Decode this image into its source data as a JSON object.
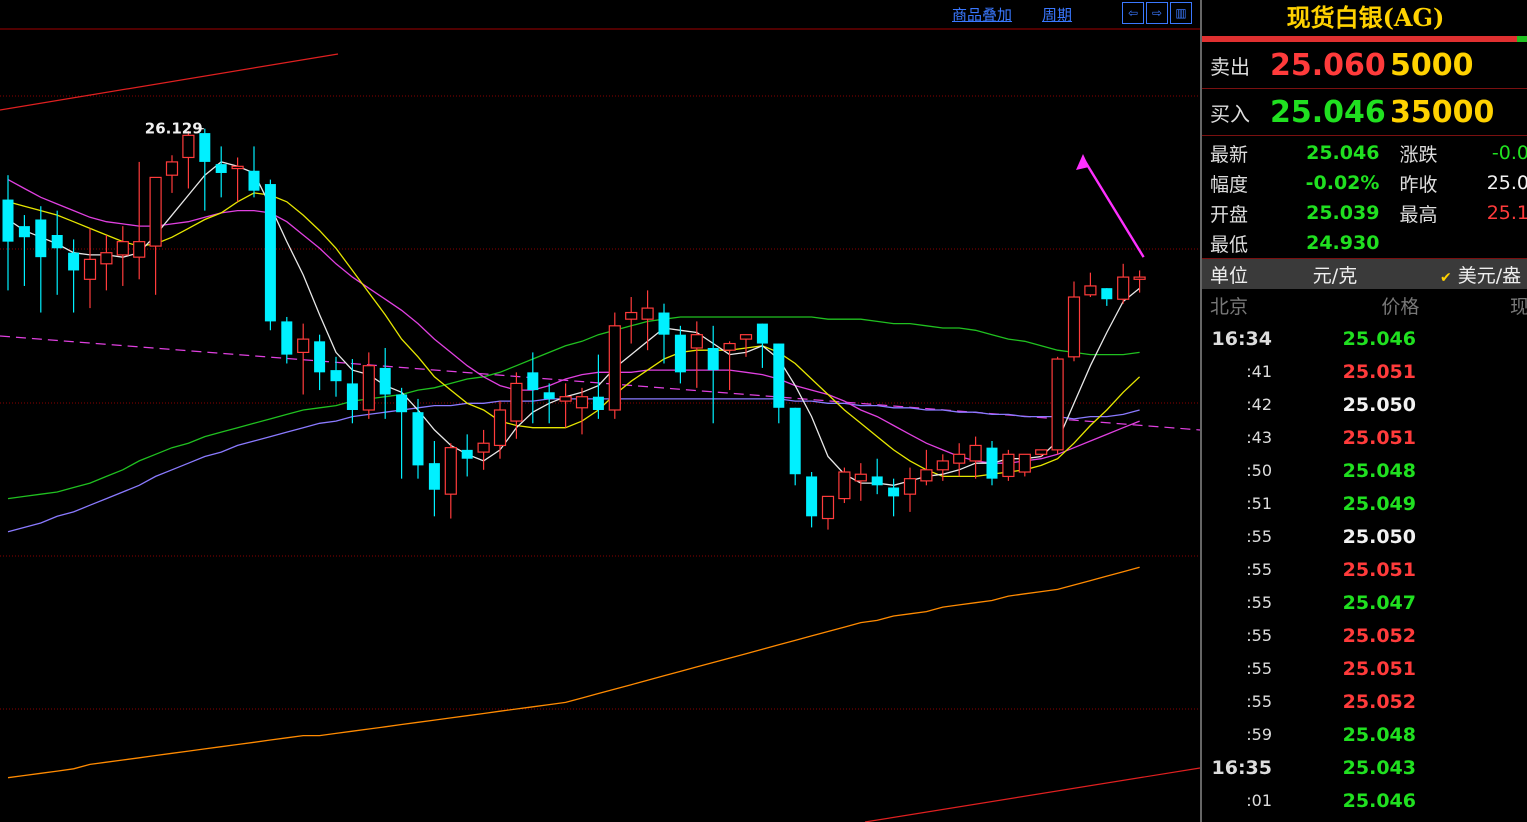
{
  "toolbar": {
    "overlay_label": "商品叠加",
    "period_label": "周期"
  },
  "colors": {
    "up": "#ff3b3b",
    "down": "#00f0ff",
    "ma5": "#e8e8e8",
    "ma10": "#e6e600",
    "ma20": "#e040e0",
    "ma30": "#20c020",
    "ma60": "#8a7aff",
    "ma120": "#ff8a00",
    "grid": "#8a0000"
  },
  "chart_data": {
    "type": "candlestick",
    "high_annotation": "26.129",
    "candles": [
      {
        "o": 25.81,
        "h": 25.92,
        "l": 25.4,
        "c": 25.62
      },
      {
        "o": 25.69,
        "h": 25.74,
        "l": 25.42,
        "c": 25.64
      },
      {
        "o": 25.72,
        "h": 25.78,
        "l": 25.3,
        "c": 25.55
      },
      {
        "o": 25.65,
        "h": 25.76,
        "l": 25.38,
        "c": 25.59
      },
      {
        "o": 25.57,
        "h": 25.63,
        "l": 25.3,
        "c": 25.49
      },
      {
        "o": 25.45,
        "h": 25.68,
        "l": 25.32,
        "c": 25.54
      },
      {
        "o": 25.52,
        "h": 25.65,
        "l": 25.4,
        "c": 25.57
      },
      {
        "o": 25.56,
        "h": 25.69,
        "l": 25.42,
        "c": 25.62
      },
      {
        "o": 25.55,
        "h": 25.98,
        "l": 25.45,
        "c": 25.62
      },
      {
        "o": 25.6,
        "h": 25.91,
        "l": 25.38,
        "c": 25.91
      },
      {
        "o": 25.92,
        "h": 26.01,
        "l": 25.84,
        "c": 25.98
      },
      {
        "o": 26.0,
        "h": 26.12,
        "l": 25.86,
        "c": 26.1
      },
      {
        "o": 26.11,
        "h": 26.13,
        "l": 25.76,
        "c": 25.98
      },
      {
        "o": 25.97,
        "h": 26.05,
        "l": 25.82,
        "c": 25.93
      },
      {
        "o": 25.95,
        "h": 26.0,
        "l": 25.8,
        "c": 25.96
      },
      {
        "o": 25.94,
        "h": 26.05,
        "l": 25.82,
        "c": 25.85
      },
      {
        "o": 25.88,
        "h": 25.9,
        "l": 25.22,
        "c": 25.26
      },
      {
        "o": 25.26,
        "h": 25.28,
        "l": 25.07,
        "c": 25.11
      },
      {
        "o": 25.12,
        "h": 25.25,
        "l": 24.93,
        "c": 25.18
      },
      {
        "o": 25.17,
        "h": 25.2,
        "l": 24.95,
        "c": 25.03
      },
      {
        "o": 25.04,
        "h": 25.1,
        "l": 24.92,
        "c": 24.99
      },
      {
        "o": 24.98,
        "h": 25.09,
        "l": 24.8,
        "c": 24.86
      },
      {
        "o": 24.86,
        "h": 25.12,
        "l": 24.82,
        "c": 25.06
      },
      {
        "o": 25.05,
        "h": 25.14,
        "l": 24.82,
        "c": 24.93
      },
      {
        "o": 24.93,
        "h": 24.96,
        "l": 24.55,
        "c": 24.85
      },
      {
        "o": 24.85,
        "h": 24.91,
        "l": 24.55,
        "c": 24.61
      },
      {
        "o": 24.62,
        "h": 24.72,
        "l": 24.38,
        "c": 24.5
      },
      {
        "o": 24.48,
        "h": 24.71,
        "l": 24.37,
        "c": 24.69
      },
      {
        "o": 24.68,
        "h": 24.75,
        "l": 24.56,
        "c": 24.64
      },
      {
        "o": 24.67,
        "h": 24.77,
        "l": 24.59,
        "c": 24.71
      },
      {
        "o": 24.7,
        "h": 24.9,
        "l": 24.64,
        "c": 24.86
      },
      {
        "o": 24.81,
        "h": 25.03,
        "l": 24.73,
        "c": 24.98
      },
      {
        "o": 25.03,
        "h": 25.12,
        "l": 24.8,
        "c": 24.95
      },
      {
        "o": 24.94,
        "h": 24.98,
        "l": 24.8,
        "c": 24.91
      },
      {
        "o": 24.9,
        "h": 24.98,
        "l": 24.78,
        "c": 24.92
      },
      {
        "o": 24.87,
        "h": 24.96,
        "l": 24.75,
        "c": 24.92
      },
      {
        "o": 24.92,
        "h": 25.11,
        "l": 24.82,
        "c": 24.86
      },
      {
        "o": 24.86,
        "h": 25.3,
        "l": 24.82,
        "c": 25.24
      },
      {
        "o": 25.27,
        "h": 25.37,
        "l": 25.16,
        "c": 25.3
      },
      {
        "o": 25.27,
        "h": 25.4,
        "l": 25.13,
        "c": 25.32
      },
      {
        "o": 25.3,
        "h": 25.34,
        "l": 25.07,
        "c": 25.2
      },
      {
        "o": 25.2,
        "h": 25.24,
        "l": 24.98,
        "c": 25.03
      },
      {
        "o": 25.14,
        "h": 25.26,
        "l": 24.96,
        "c": 25.2
      },
      {
        "o": 25.14,
        "h": 25.24,
        "l": 24.8,
        "c": 25.04
      },
      {
        "o": 25.13,
        "h": 25.17,
        "l": 24.95,
        "c": 25.16
      },
      {
        "o": 25.18,
        "h": 25.2,
        "l": 25.1,
        "c": 25.2
      },
      {
        "o": 25.25,
        "h": 25.25,
        "l": 25.05,
        "c": 25.16
      },
      {
        "o": 25.16,
        "h": 25.16,
        "l": 24.8,
        "c": 24.87
      },
      {
        "o": 24.87,
        "h": 24.87,
        "l": 24.52,
        "c": 24.57
      },
      {
        "o": 24.56,
        "h": 24.58,
        "l": 24.33,
        "c": 24.38
      },
      {
        "o": 24.37,
        "h": 24.46,
        "l": 24.32,
        "c": 24.47
      },
      {
        "o": 24.46,
        "h": 24.6,
        "l": 24.44,
        "c": 24.58
      },
      {
        "o": 24.54,
        "h": 24.62,
        "l": 24.45,
        "c": 24.57
      },
      {
        "o": 24.56,
        "h": 24.64,
        "l": 24.48,
        "c": 24.52
      },
      {
        "o": 24.51,
        "h": 24.55,
        "l": 24.38,
        "c": 24.47
      },
      {
        "o": 24.48,
        "h": 24.6,
        "l": 24.4,
        "c": 24.55
      },
      {
        "o": 24.54,
        "h": 24.68,
        "l": 24.52,
        "c": 24.59
      },
      {
        "o": 24.59,
        "h": 24.66,
        "l": 24.54,
        "c": 24.63
      },
      {
        "o": 24.62,
        "h": 24.71,
        "l": 24.56,
        "c": 24.66
      },
      {
        "o": 24.63,
        "h": 24.74,
        "l": 24.55,
        "c": 24.7
      },
      {
        "o": 24.69,
        "h": 24.72,
        "l": 24.52,
        "c": 24.55
      },
      {
        "o": 24.56,
        "h": 24.68,
        "l": 24.54,
        "c": 24.66
      },
      {
        "o": 24.58,
        "h": 24.66,
        "l": 24.56,
        "c": 24.66
      },
      {
        "o": 24.66,
        "h": 24.68,
        "l": 24.65,
        "c": 24.68
      },
      {
        "o": 24.68,
        "h": 25.1,
        "l": 24.66,
        "c": 25.09
      },
      {
        "o": 25.1,
        "h": 25.44,
        "l": 25.08,
        "c": 25.37
      },
      {
        "o": 25.38,
        "h": 25.48,
        "l": 25.37,
        "c": 25.42
      },
      {
        "o": 25.41,
        "h": 25.41,
        "l": 25.33,
        "c": 25.36
      },
      {
        "o": 25.36,
        "h": 25.52,
        "l": 25.34,
        "c": 25.46
      },
      {
        "o": 25.45,
        "h": 25.49,
        "l": 25.39,
        "c": 25.46
      }
    ],
    "ma5": [
      25.72,
      25.67,
      25.64,
      25.61,
      25.57,
      25.56,
      25.56,
      25.55,
      25.57,
      25.65,
      25.74,
      25.83,
      25.92,
      25.98,
      25.96,
      25.93,
      25.78,
      25.62,
      25.47,
      25.29,
      25.12,
      25.04,
      25.02,
      24.97,
      24.94,
      24.86,
      24.77,
      24.7,
      24.66,
      24.63,
      24.68,
      24.78,
      24.85,
      24.89,
      24.92,
      24.94,
      24.97,
      25.05,
      25.11,
      25.17,
      25.23,
      25.22,
      25.21,
      25.16,
      25.11,
      25.12,
      25.15,
      25.09,
      24.97,
      24.83,
      24.65,
      24.57,
      24.53,
      24.53,
      24.52,
      24.54,
      24.56,
      24.57,
      24.59,
      24.62,
      24.62,
      24.64,
      24.64,
      24.65,
      24.72,
      24.89,
      25.06,
      25.21,
      25.35,
      25.41
    ],
    "ma10": [
      25.8,
      25.78,
      25.76,
      25.74,
      25.71,
      25.68,
      25.65,
      25.62,
      25.6,
      25.61,
      25.64,
      25.68,
      25.72,
      25.75,
      25.8,
      25.84,
      25.83,
      25.8,
      25.74,
      25.67,
      25.59,
      25.49,
      25.39,
      25.29,
      25.18,
      25.1,
      25.01,
      24.95,
      24.89,
      24.86,
      24.81,
      24.79,
      24.78,
      24.78,
      24.78,
      24.81,
      24.86,
      24.93,
      24.99,
      25.04,
      25.09,
      25.12,
      25.13,
      25.13,
      25.13,
      25.14,
      25.15,
      25.12,
      25.07,
      25.0,
      24.93,
      24.86,
      24.8,
      24.74,
      24.68,
      24.63,
      24.59,
      24.56,
      24.56,
      24.56,
      24.57,
      24.58,
      24.59,
      24.61,
      24.64,
      24.71,
      24.79,
      24.86,
      24.94,
      25.01
    ],
    "ma20": [
      25.9,
      25.86,
      25.82,
      25.79,
      25.76,
      25.73,
      25.71,
      25.7,
      25.69,
      25.69,
      25.7,
      25.71,
      25.73,
      25.75,
      25.76,
      25.76,
      25.75,
      25.71,
      25.65,
      25.59,
      25.52,
      25.46,
      25.41,
      25.36,
      25.31,
      25.25,
      25.18,
      25.12,
      25.06,
      25.01,
      24.97,
      24.95,
      24.95,
      24.97,
      25.0,
      25.02,
      25.03,
      25.03,
      25.03,
      25.04,
      25.04,
      25.04,
      25.04,
      25.04,
      25.04,
      25.03,
      25.02,
      25.0,
      24.97,
      24.95,
      24.93,
      24.9,
      24.86,
      24.83,
      24.79,
      24.75,
      24.71,
      24.68,
      24.65,
      24.63,
      24.62,
      24.62,
      24.63,
      24.64,
      24.66,
      24.69,
      24.72,
      24.75,
      24.78,
      24.81
    ],
    "ma30": [
      24.46,
      24.47,
      24.48,
      24.49,
      24.51,
      24.53,
      24.56,
      24.59,
      24.63,
      24.66,
      24.69,
      24.71,
      24.74,
      24.76,
      24.78,
      24.8,
      24.82,
      24.84,
      24.86,
      24.87,
      24.88,
      24.9,
      24.91,
      24.92,
      24.93,
      24.95,
      24.96,
      24.98,
      25.0,
      25.01,
      25.03,
      25.06,
      25.09,
      25.12,
      25.15,
      25.17,
      25.2,
      25.22,
      25.24,
      25.26,
      25.27,
      25.28,
      25.28,
      25.28,
      25.28,
      25.28,
      25.28,
      25.28,
      25.28,
      25.28,
      25.27,
      25.27,
      25.27,
      25.26,
      25.25,
      25.25,
      25.24,
      25.23,
      25.23,
      25.22,
      25.2,
      25.18,
      25.17,
      25.15,
      25.13,
      25.12,
      25.11,
      25.11,
      25.11,
      25.12
    ],
    "ma60": [
      24.31,
      24.33,
      24.35,
      24.38,
      24.4,
      24.43,
      24.46,
      24.49,
      24.52,
      24.56,
      24.59,
      24.62,
      24.65,
      24.67,
      24.7,
      24.72,
      24.74,
      24.76,
      24.78,
      24.8,
      24.81,
      24.83,
      24.84,
      24.85,
      24.86,
      24.87,
      24.88,
      24.88,
      24.89,
      24.89,
      24.9,
      24.9,
      24.9,
      24.91,
      24.91,
      24.91,
      24.91,
      24.91,
      24.91,
      24.91,
      24.91,
      24.91,
      24.91,
      24.91,
      24.91,
      24.91,
      24.91,
      24.91,
      24.9,
      24.9,
      24.89,
      24.89,
      24.88,
      24.88,
      24.87,
      24.87,
      24.86,
      24.86,
      24.85,
      24.85,
      24.84,
      24.84,
      24.83,
      24.83,
      24.83,
      24.82,
      24.83,
      24.83,
      24.84,
      24.86
    ],
    "ma120": [
      23.2,
      23.21,
      23.22,
      23.23,
      23.24,
      23.26,
      23.27,
      23.28,
      23.29,
      23.3,
      23.31,
      23.32,
      23.33,
      23.34,
      23.35,
      23.36,
      23.37,
      23.38,
      23.39,
      23.39,
      23.4,
      23.41,
      23.42,
      23.43,
      23.44,
      23.45,
      23.46,
      23.47,
      23.48,
      23.49,
      23.5,
      23.51,
      23.52,
      23.53,
      23.54,
      23.56,
      23.58,
      23.6,
      23.62,
      23.64,
      23.66,
      23.68,
      23.7,
      23.72,
      23.74,
      23.76,
      23.78,
      23.8,
      23.82,
      23.84,
      23.86,
      23.88,
      23.9,
      23.91,
      23.93,
      23.94,
      23.95,
      23.97,
      23.98,
      23.99,
      24.0,
      24.02,
      24.03,
      24.04,
      24.05,
      24.07,
      24.09,
      24.11,
      24.13,
      24.15
    ],
    "ylim": [
      23.0,
      26.58
    ]
  },
  "quote": {
    "title": "现货白银(AG)",
    "ask_label": "卖出",
    "ask_price": "25.060",
    "ask_vol": "5000",
    "bid_label": "买入",
    "bid_price": "25.046",
    "bid_vol": "35000",
    "stats": [
      {
        "k": "最新",
        "v": "25.046",
        "k2": "涨跌",
        "v2": "-0.0"
      },
      {
        "k": "幅度",
        "v": "-0.02%",
        "k2": "昨收",
        "v2": "25.0"
      },
      {
        "k": "开盘",
        "v": "25.039",
        "k2": "最高",
        "v2": "25.1"
      },
      {
        "k": "最低",
        "v": "24.930",
        "k2": "",
        "v2": ""
      }
    ],
    "unit_label": "单位",
    "unit_value": "元/克",
    "unit_alt": "美元/盎",
    "tick_head": {
      "c1": "北京",
      "c2": "价格",
      "c3": "现"
    },
    "ticks": [
      {
        "t": "16:34",
        "p": "25.046",
        "c": "green",
        "hh": true
      },
      {
        "t": ":41",
        "p": "25.051",
        "c": "red"
      },
      {
        "t": ":42",
        "p": "25.050",
        "c": "white"
      },
      {
        "t": ":43",
        "p": "25.051",
        "c": "red"
      },
      {
        "t": ":50",
        "p": "25.048",
        "c": "green"
      },
      {
        "t": ":51",
        "p": "25.049",
        "c": "green"
      },
      {
        "t": ":55",
        "p": "25.050",
        "c": "white"
      },
      {
        "t": ":55",
        "p": "25.051",
        "c": "red"
      },
      {
        "t": ":55",
        "p": "25.047",
        "c": "green"
      },
      {
        "t": ":55",
        "p": "25.052",
        "c": "red"
      },
      {
        "t": ":55",
        "p": "25.051",
        "c": "red"
      },
      {
        "t": ":55",
        "p": "25.052",
        "c": "red"
      },
      {
        "t": ":59",
        "p": "25.048",
        "c": "green"
      },
      {
        "t": "16:35",
        "p": "25.043",
        "c": "green",
        "hh": true
      },
      {
        "t": ":01",
        "p": "25.046",
        "c": "green"
      }
    ]
  }
}
